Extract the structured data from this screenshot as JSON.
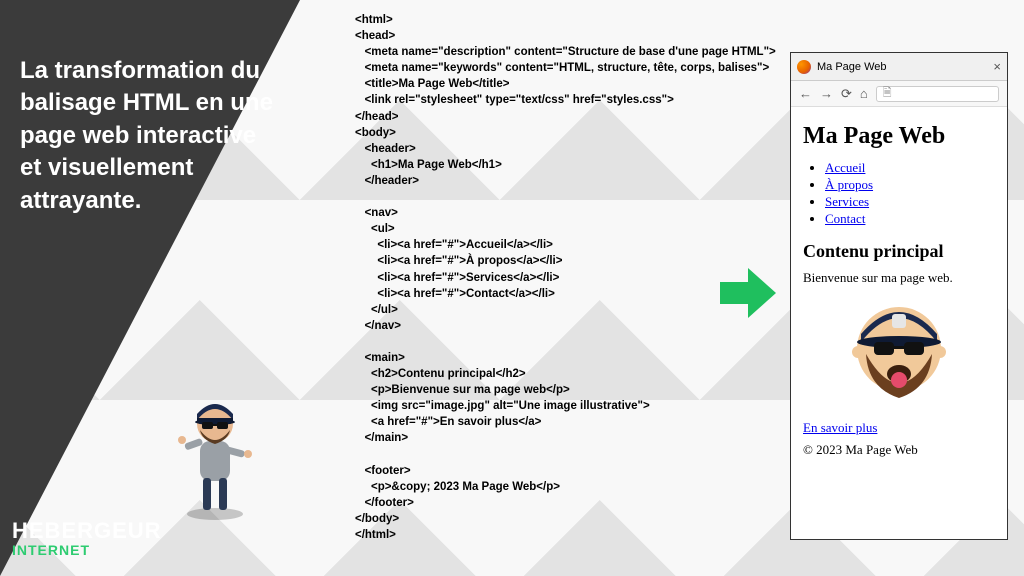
{
  "left": {
    "headline": "La transformation du balisage HTML en une page web interactive et visuellement attrayante.",
    "logo_line1": "HEBERGEUR",
    "logo_line2": "INTERNET"
  },
  "code": {
    "lines": [
      "<html>",
      "<head>",
      "   <meta name=\"description\" content=\"Structure de base d'une page HTML\">",
      "   <meta name=\"keywords\" content=\"HTML, structure, tête, corps, balises\">",
      "   <title>Ma Page Web</title>",
      "   <link rel=\"stylesheet\" type=\"text/css\" href=\"styles.css\">",
      "</head>",
      "<body>",
      "   <header>",
      "     <h1>Ma Page Web</h1>",
      "   </header>",
      "",
      "   <nav>",
      "     <ul>",
      "       <li><a href=\"#\">Accueil</a></li>",
      "       <li><a href=\"#\">À propos</a></li>",
      "       <li><a href=\"#\">Services</a></li>",
      "       <li><a href=\"#\">Contact</a></li>",
      "     </ul>",
      "   </nav>",
      "",
      "   <main>",
      "     <h2>Contenu principal</h2>",
      "     <p>Bienvenue sur ma page web</p>",
      "     <img src=\"image.jpg\" alt=\"Une image illustrative\">",
      "     <a href=\"#\">En savoir plus</a>",
      "   </main>",
      "",
      "   <footer>",
      "     <p>&copy; 2023 Ma Page Web</p>",
      "   </footer>",
      "</body>",
      "</html>"
    ]
  },
  "browser": {
    "tab_title": "Ma Page Web",
    "tab_close": "×",
    "nav": {
      "back": "←",
      "forward": "→",
      "reload": "⟳",
      "home": "⌂",
      "doc": "🗎"
    },
    "page": {
      "h1": "Ma Page Web",
      "links": [
        "Accueil",
        "À propos",
        "Services",
        "Contact"
      ],
      "h2": "Contenu principal",
      "welcome": "Bienvenue sur ma page web.",
      "more": "En savoir plus",
      "copyright": "© 2023 Ma Page Web"
    }
  }
}
